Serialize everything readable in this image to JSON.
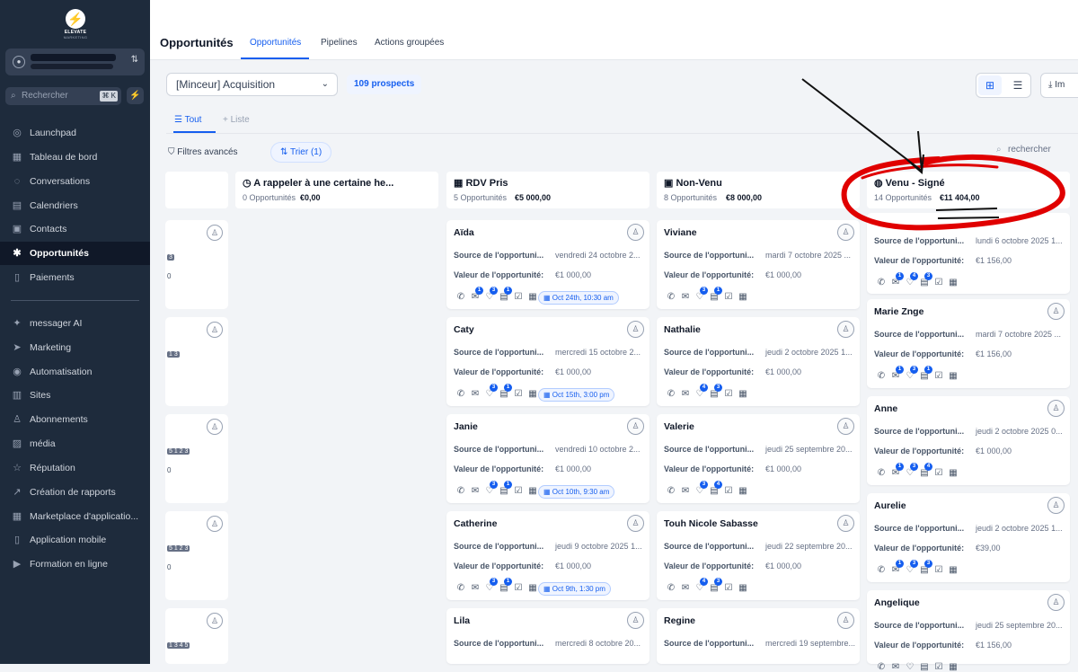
{
  "sidebar": {
    "logo_line1": "ELEVATE",
    "logo_line2": "MARKETING",
    "search_placeholder": "Rechercher",
    "search_shortcut": "⌘ K",
    "items": [
      {
        "label": "Launchpad",
        "icon": "rocket-icon"
      },
      {
        "label": "Tableau de bord",
        "icon": "dashboard-icon"
      },
      {
        "label": "Conversations",
        "icon": "chat-icon"
      },
      {
        "label": "Calendriers",
        "icon": "calendar-icon"
      },
      {
        "label": "Contacts",
        "icon": "contacts-icon"
      },
      {
        "label": "Opportunités",
        "icon": "opportunities-icon"
      },
      {
        "label": "Paiements",
        "icon": "payments-icon"
      },
      {
        "label": "messager AI",
        "icon": "sparkle-icon"
      },
      {
        "label": "Marketing",
        "icon": "send-icon"
      },
      {
        "label": "Automatisation",
        "icon": "automation-icon"
      },
      {
        "label": "Sites",
        "icon": "sites-icon"
      },
      {
        "label": "Abonnements",
        "icon": "membership-icon"
      },
      {
        "label": "média",
        "icon": "media-icon"
      },
      {
        "label": "Réputation",
        "icon": "star-icon"
      },
      {
        "label": "Création de rapports",
        "icon": "chart-icon"
      },
      {
        "label": "Marketplace d'applicatio...",
        "icon": "apps-icon"
      },
      {
        "label": "Application mobile",
        "icon": "mobile-icon"
      },
      {
        "label": "Formation en ligne",
        "icon": "video-icon"
      }
    ]
  },
  "header": {
    "title": "Opportunités",
    "tabs": [
      "Opportunités",
      "Pipelines",
      "Actions groupées"
    ]
  },
  "toolbar": {
    "pipeline": "[Minceur] Acquisition",
    "prospects": "109 prospects",
    "import_label": "Im",
    "subtab_all": "Tout",
    "subtab_list": "Liste",
    "filters": "Filtres avancés",
    "sort": "Trier (1)",
    "search_placeholder": "rechercher"
  },
  "labels": {
    "source": "Source de l'opportuni...",
    "value": "Valeur de l'opportunité:"
  },
  "columns": [
    {
      "title": "A rappeler à une certaine he...",
      "count": "0 Opportunités",
      "amount": "€0,00",
      "cards": []
    },
    {
      "title": "RDV Pris",
      "count": "5 Opportunités",
      "amount": "€5 000,00",
      "cards": [
        {
          "name": "Aïda",
          "source": "vendredi 24 octobre 2...",
          "value": "€1 000,00",
          "appt": "Oct 24th, 10:30 am",
          "badges": [
            "1",
            "3",
            "1"
          ]
        },
        {
          "name": "Caty",
          "source": "mercredi 15 octobre 2...",
          "value": "€1 000,00",
          "appt": "Oct 15th, 3:00 pm",
          "badges": [
            "",
            "3",
            "1"
          ]
        },
        {
          "name": "Janie",
          "source": "vendredi 10 octobre 2...",
          "value": "€1 000,00",
          "appt": "Oct 10th, 9:30 am",
          "badges": [
            "",
            "3",
            "1"
          ]
        },
        {
          "name": "Catherine",
          "source": "jeudi 9 octobre 2025 1...",
          "value": "€1 000,00",
          "appt": "Oct 9th, 1:30 pm",
          "badges": [
            "",
            "3",
            "1"
          ]
        },
        {
          "name": "Lila",
          "source": "mercredi 8 octobre 20...",
          "value": "",
          "appt": "",
          "badges": []
        }
      ]
    },
    {
      "title": "Non-Venu",
      "count": "8 Opportunités",
      "amount": "€8 000,00",
      "cards": [
        {
          "name": "Viviane",
          "source": "mardi 7 octobre 2025 ...",
          "value": "€1 000,00",
          "badges": [
            "",
            "3",
            "1"
          ]
        },
        {
          "name": "Nathalie",
          "source": "jeudi 2 octobre 2025 1...",
          "value": "€1 000,00",
          "badges": [
            "",
            "4",
            "3"
          ]
        },
        {
          "name": "Valerie",
          "source": "jeudi 25 septembre 20...",
          "value": "€1 000,00",
          "badges": [
            "",
            "3",
            "4"
          ]
        },
        {
          "name": "Touh Nicole Sabasse",
          "source": "jeudi 22 septembre 20...",
          "value": "€1 000,00",
          "badges": [
            "",
            "4",
            "3"
          ]
        },
        {
          "name": "Regine",
          "source": "mercredi 19 septembre...",
          "value": "",
          "badges": []
        }
      ]
    },
    {
      "title": "Venu - Signé",
      "count": "14 Opportunités",
      "amount": "€11 404,00",
      "cards": [
        {
          "name": "",
          "source": "lundi 6 octobre 2025 1...",
          "value": "€1 156,00",
          "badges": [
            "1",
            "4",
            "3"
          ]
        },
        {
          "name": "Marie Znge",
          "source": "mardi 7 octobre 2025 ...",
          "value": "€1 156,00",
          "badges": [
            "1",
            "3",
            "1"
          ]
        },
        {
          "name": "Anne",
          "source": "jeudi 2 octobre 2025 0...",
          "value": "€1 000,00",
          "badges": [
            "1",
            "3",
            "4"
          ]
        },
        {
          "name": "Aurelie",
          "source": "jeudi 2 octobre 2025 1...",
          "value": "€39,00",
          "badges": [
            "1",
            "3",
            "3"
          ]
        },
        {
          "name": "Angelique",
          "source": "jeudi 25 septembre 20...",
          "value": "€1 156,00",
          "badges": []
        }
      ]
    }
  ],
  "left_partial_tags": [
    "3",
    "1 3",
    "5 1 2 3",
    "5 1 2 3",
    "1 3 4 5"
  ],
  "left_partial_zero": "0",
  "colors": {
    "sidebar_bg": "#1e2b3c",
    "accent": "#155eef",
    "annotation": "#e00000"
  }
}
